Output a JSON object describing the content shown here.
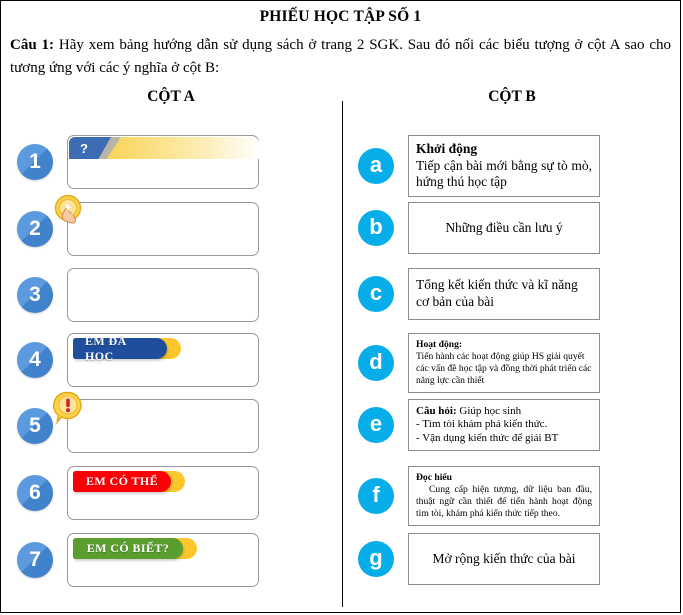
{
  "document": {
    "title": "PHIẾU HỌC TẬP SỐ 1",
    "question_label": "Câu 1:",
    "question_text": " Hãy xem bảng hướng dẫn sử dụng sách ở trang 2 SGK. Sau đó nối các biểu tượng ở cột A sao cho tương ứng với các ý nghĩa ở cột B:"
  },
  "columns": {
    "left_heading": "CỘT A",
    "right_heading": "CỘT B"
  },
  "colors": {
    "number_badge": "#4a8ed6",
    "letter_badge": "#07ade9",
    "banner_blue": "#1f4e9c",
    "banner_red": "#fb0007",
    "banner_green": "#5a9e30",
    "banner_yellow": "#fbc72c",
    "box_border": "#8d8d8d"
  },
  "column_a": [
    {
      "badge": "1",
      "icon": "question-mark-ribbon",
      "banner_text": "?",
      "banner_style": "question"
    },
    {
      "badge": "2",
      "icon": "pointing-hand-emblem",
      "banner_text": "",
      "banner_style": "emblem"
    },
    {
      "badge": "3",
      "icon": "none",
      "banner_text": "",
      "banner_style": "plain"
    },
    {
      "badge": "4",
      "icon": "label-ribbon-blue",
      "banner_text": "EM ĐÃ HỌC",
      "banner_style": "label"
    },
    {
      "badge": "5",
      "icon": "exclamation-bubble-emblem",
      "banner_text": "",
      "banner_style": "emblem"
    },
    {
      "badge": "6",
      "icon": "label-ribbon-red",
      "banner_text": "EM CÓ THỂ",
      "banner_style": "label"
    },
    {
      "badge": "7",
      "icon": "label-ribbon-green",
      "banner_text": "EM CÓ BIẾT?",
      "banner_style": "label"
    }
  ],
  "column_b": [
    {
      "badge": "a",
      "heading": "Khởi động",
      "lines": [
        "Tiếp cận bài mới bằng sự tò mò, hứng thú học tập"
      ],
      "size": "fs14",
      "align": "just"
    },
    {
      "badge": "b",
      "heading": "",
      "lines": [
        "Những điều cần lưu ý"
      ],
      "size": "fs14",
      "align": "center"
    },
    {
      "badge": "c",
      "heading": "",
      "lines": [
        "Tổng kết kiến thức và kĩ năng cơ bản của bài"
      ],
      "size": "fs14",
      "align": "left"
    },
    {
      "badge": "d",
      "heading": "Hoạt động:",
      "lines": [
        "Tiến hành các hoạt động giúp HS giải quyết các vấn đề học tập và đồng thời phát triển các năng lực cần thiết"
      ],
      "size": "fs10",
      "align": "left"
    },
    {
      "badge": "e",
      "heading": "Câu hỏi:",
      "lines": [
        " Giúp học sinh",
        "- Tìm tòi khám phá kiến thức.",
        "- Vận dụng kiến thức để giải BT"
      ],
      "size": "fs12",
      "align": "left"
    },
    {
      "badge": "f",
      "heading": "Đọc hiểu",
      "lines": [
        "Cung cấp hiện tượng, dữ liệu ban đầu, thuật ngữ cần thiết để tiến hành hoạt động tìm tòi, khám phá kiến thức tiếp theo."
      ],
      "size": "fs10",
      "align": "just"
    },
    {
      "badge": "g",
      "heading": "",
      "lines": [
        "Mở rộng kiến thức của bài"
      ],
      "size": "fs14",
      "align": "center"
    }
  ]
}
